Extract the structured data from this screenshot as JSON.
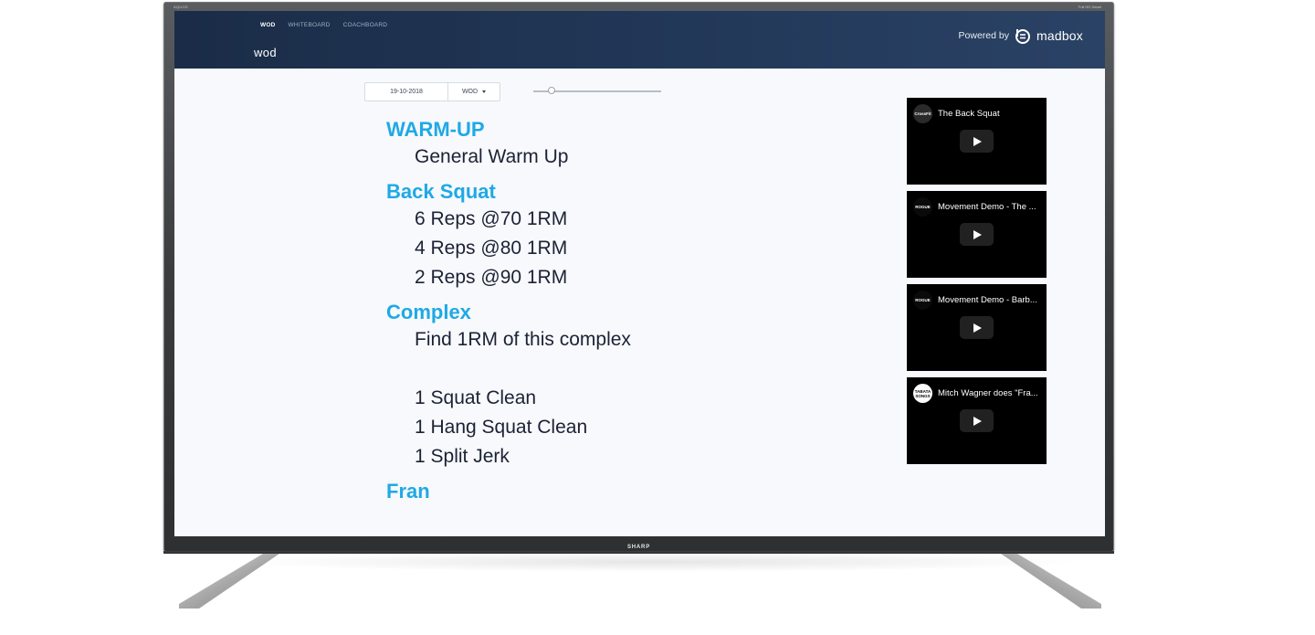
{
  "tv": {
    "brand_top_left": "AQUOS",
    "brand_top_right": "Full HD  Smart",
    "brand_bottom": "SHARP"
  },
  "app": {
    "nav": [
      {
        "label": "WOD",
        "active": true
      },
      {
        "label": "WHITEBOARD",
        "active": false
      },
      {
        "label": "COACHBOARD",
        "active": false
      }
    ],
    "title": "wod",
    "powered_by": "Powered by",
    "brand_name": "madbox"
  },
  "controls": {
    "date": "19-10-2018",
    "mode": "WOD",
    "zoom_fraction": 0.14
  },
  "workout": [
    {
      "title": "WARM-UP",
      "lines": [
        "General Warm Up"
      ]
    },
    {
      "title": "Back Squat",
      "lines": [
        "6 Reps @70 1RM",
        "4 Reps @80 1RM",
        "2 Reps @90 1RM"
      ]
    },
    {
      "title": "Complex",
      "lines": [
        "Find 1RM of this complex",
        "",
        "1 Squat Clean",
        "1 Hang Squat Clean",
        "1 Split Jerk"
      ]
    },
    {
      "title": "Fran",
      "lines": []
    }
  ],
  "videos": [
    {
      "channel": "CrossFit",
      "title": "The Back Squat",
      "avatar_style": "dark"
    },
    {
      "channel": "ROGUE",
      "title": "Movement Demo - The ...",
      "avatar_style": "black"
    },
    {
      "channel": "ROGUE",
      "title": "Movement Demo - Barb...",
      "avatar_style": "black"
    },
    {
      "channel": "TABATA SONGS",
      "title": "Mitch Wagner does \"Fra...",
      "avatar_style": "light"
    }
  ],
  "colors": {
    "accent": "#1fa9e6",
    "header_bg": "#1a2c47",
    "text": "#1c2235"
  }
}
